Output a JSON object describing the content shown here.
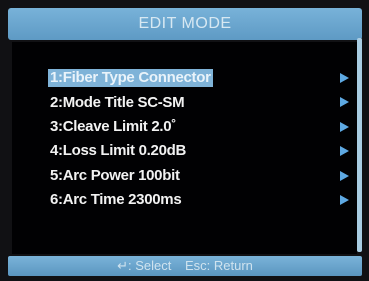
{
  "title_bar": {
    "title": "EDIT MODE"
  },
  "menu": {
    "selected_index": 0,
    "items": [
      {
        "label": "1:Fiber Type Connector",
        "arrow_icon": "right-triangle-icon"
      },
      {
        "label": "2:Mode Title SC-SM",
        "arrow_icon": "right-triangle-icon"
      },
      {
        "label": "3:Cleave Limit 2.0˚",
        "arrow_icon": "right-triangle-icon"
      },
      {
        "label": "4:Loss Limit 0.20dB",
        "arrow_icon": "right-triangle-icon"
      },
      {
        "label": "5:Arc Power 100bit",
        "arrow_icon": "right-triangle-icon"
      },
      {
        "label": "6:Arc Time 2300ms",
        "arrow_icon": "right-triangle-icon"
      }
    ]
  },
  "status_bar": {
    "select_hint": "↵: Select",
    "return_hint": "Esc: Return"
  },
  "colors": {
    "accent": "#6fa8d2",
    "selected_bg": "#7fb3d8",
    "arrow": "#5ea9e3",
    "background": "#010103",
    "text": "#f2f2f2"
  }
}
